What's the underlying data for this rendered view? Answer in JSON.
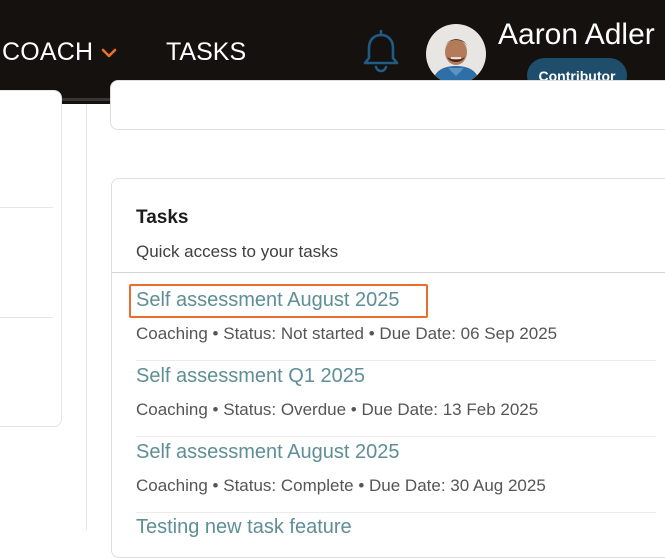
{
  "nav": {
    "coach_label": "COACH",
    "tasks_label": "TASKS"
  },
  "user": {
    "name": "Aaron Adler",
    "role": "Contributor"
  },
  "tasks_card": {
    "title": "Tasks",
    "subtitle": "Quick access to your tasks",
    "items": [
      {
        "title": "Self assessment August 2025",
        "meta": "Coaching • Status: Not started • Due Date: 06 Sep 2025"
      },
      {
        "title": "Self assessment Q1 2025",
        "meta": "Coaching • Status: Overdue • Due Date: 13 Feb 2025"
      },
      {
        "title": "Self assessment August 2025",
        "meta": "Coaching • Status: Complete • Due Date: 30 Aug 2025"
      },
      {
        "title": "Testing new task feature"
      }
    ]
  },
  "colors": {
    "topbar": "#14110f",
    "accent": "#ec6e2c",
    "badge": "#1f4e6d",
    "link": "#5e8e98",
    "bell": "#1f5d86"
  },
  "icons": {
    "chevron": "chevron-down-icon",
    "bell": "bell-icon"
  }
}
